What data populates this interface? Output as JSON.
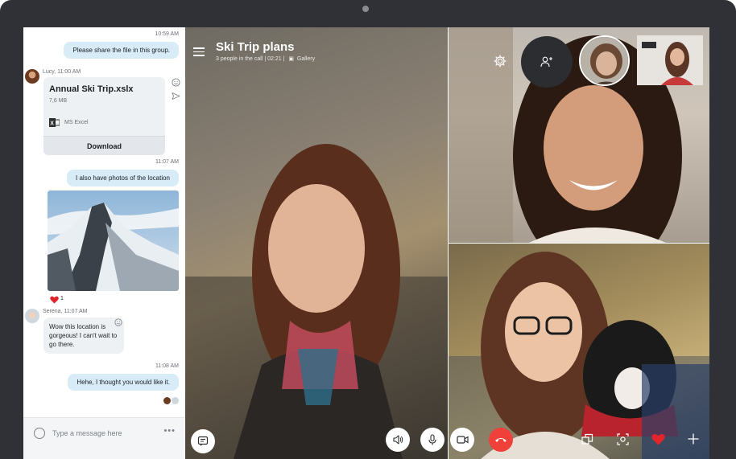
{
  "chat": {
    "messages": [
      {
        "time": "10:59 AM",
        "text": "Please share the file in this group."
      },
      {
        "sender": "Lucy, 11:00 AM"
      },
      {
        "time": "11:07 AM",
        "text": "I also have photos of the location"
      },
      {
        "sender": "Serena, 11:07 AM",
        "text": "Wow this location is gorgeous! I can't wait to go there."
      },
      {
        "time": "11:08 AM",
        "text": "Hehe, I thought you would like it."
      }
    ],
    "file": {
      "name": "Annual Ski Trip.xslx",
      "size": "7,6 MB",
      "app": "MS Excel",
      "download_label": "Download"
    },
    "reaction_count": "1",
    "composer": {
      "placeholder": "Type a message here",
      "more": "•••"
    }
  },
  "call": {
    "title": "Ski Trip plans",
    "subtitle": "3 people in the call | 02:21 |",
    "gallery_label": "Gallery"
  },
  "colors": {
    "accent": "#d8ecf8",
    "end_call": "#f0403a",
    "heart": "#e3242b",
    "frame": "#2f3136"
  },
  "icons": [
    "hamburger-icon",
    "gear-icon",
    "add-person-icon",
    "emoji-icon",
    "send-icon",
    "excel-icon",
    "heart-icon",
    "chat-icon",
    "speaker-icon",
    "mic-icon",
    "video-icon",
    "hang-up-icon",
    "switch-camera-icon",
    "screenshot-icon",
    "plus-icon",
    "gallery-icon"
  ]
}
